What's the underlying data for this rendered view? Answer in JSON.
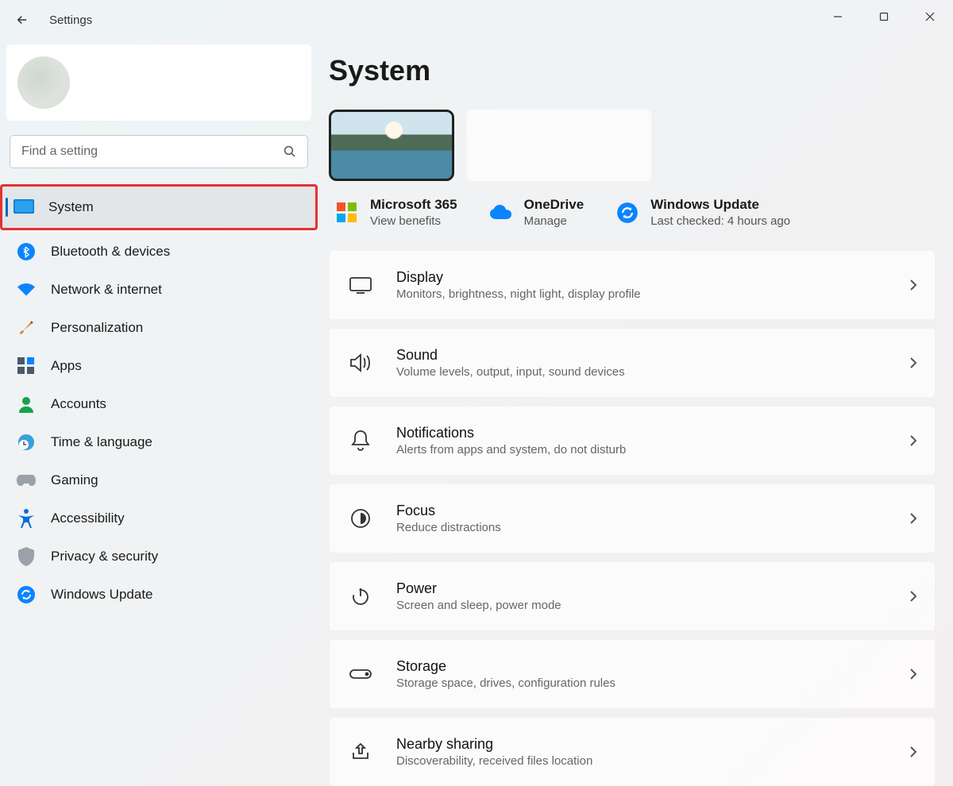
{
  "app": {
    "title": "Settings"
  },
  "search": {
    "placeholder": "Find a setting"
  },
  "sidebar": {
    "items": [
      {
        "label": "System"
      },
      {
        "label": "Bluetooth & devices"
      },
      {
        "label": "Network & internet"
      },
      {
        "label": "Personalization"
      },
      {
        "label": "Apps"
      },
      {
        "label": "Accounts"
      },
      {
        "label": "Time & language"
      },
      {
        "label": "Gaming"
      },
      {
        "label": "Accessibility"
      },
      {
        "label": "Privacy & security"
      },
      {
        "label": "Windows Update"
      }
    ]
  },
  "page": {
    "title": "System"
  },
  "services": {
    "ms365": {
      "title": "Microsoft 365",
      "sub": "View benefits"
    },
    "onedrive": {
      "title": "OneDrive",
      "sub": "Manage"
    },
    "update": {
      "title": "Windows Update",
      "sub": "Last checked: 4 hours ago"
    }
  },
  "cards": [
    {
      "title": "Display",
      "sub": "Monitors, brightness, night light, display profile"
    },
    {
      "title": "Sound",
      "sub": "Volume levels, output, input, sound devices"
    },
    {
      "title": "Notifications",
      "sub": "Alerts from apps and system, do not disturb"
    },
    {
      "title": "Focus",
      "sub": "Reduce distractions"
    },
    {
      "title": "Power",
      "sub": "Screen and sleep, power mode"
    },
    {
      "title": "Storage",
      "sub": "Storage space, drives, configuration rules"
    },
    {
      "title": "Nearby sharing",
      "sub": "Discoverability, received files location"
    }
  ]
}
